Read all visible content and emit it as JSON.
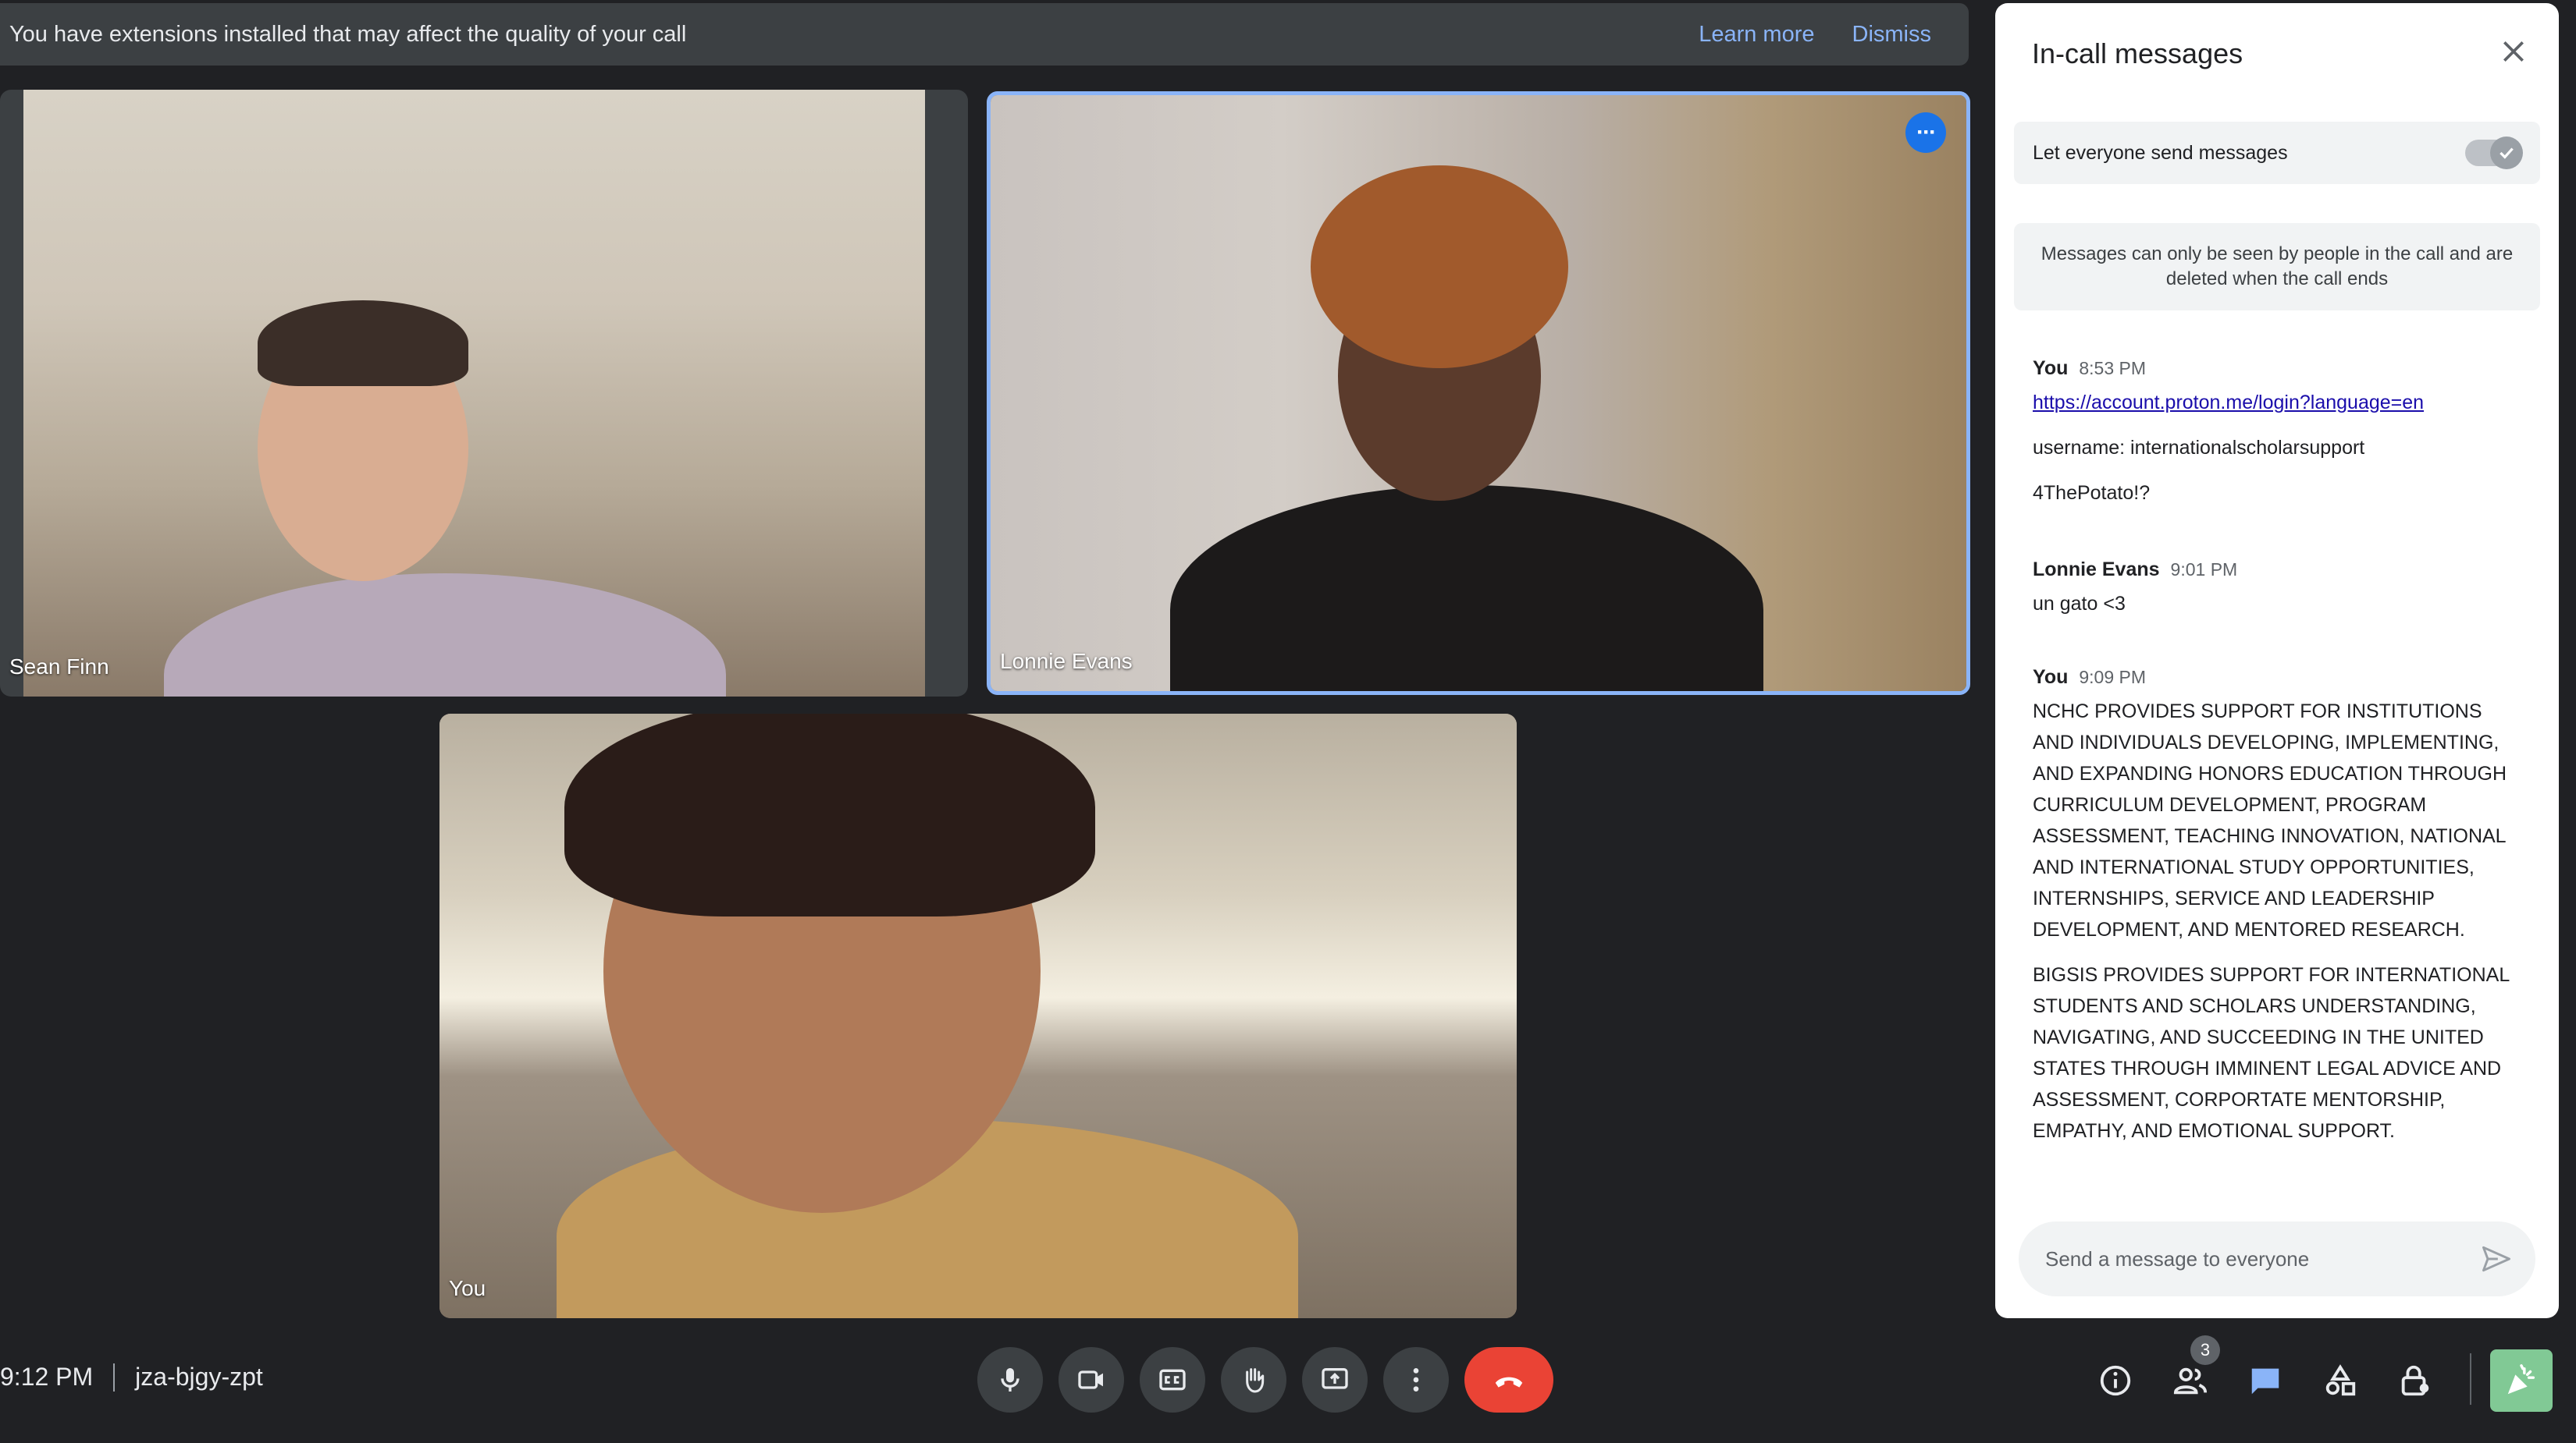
{
  "banner": {
    "text": "You have extensions installed that may affect the quality of your call",
    "learn_more": "Learn more",
    "dismiss": "Dismiss"
  },
  "tiles": {
    "sean": "Sean Finn",
    "lonnie": "Lonnie Evans",
    "you": "You"
  },
  "panel": {
    "title": "In-call messages",
    "toggle_label": "Let everyone send messages",
    "toggle_on": true,
    "info": "Messages can only be seen by people in the call and are deleted when the call ends",
    "messages": [
      {
        "sender": "You",
        "time": "8:53 PM",
        "link": "https://account.proton.me/login?language=en",
        "lines": [
          "username: internationalscholarsupport",
          "4ThePotato!?"
        ]
      },
      {
        "sender": "Lonnie Evans",
        "time": "9:01 PM",
        "lines": [
          "un gato <3"
        ]
      },
      {
        "sender": "You",
        "time": "9:09 PM",
        "lines": [
          "NCHC PROVIDES SUPPORT FOR INSTITUTIONS AND INDIVIDUALS DEVELOPING, IMPLEMENTING, AND EXPANDING HONORS EDUCATION THROUGH CURRICULUM DEVELOPMENT, PROGRAM ASSESSMENT, TEACHING INNOVATION, NATIONAL AND INTERNATIONAL STUDY OPPORTUNITIES, INTERNSHIPS, SERVICE AND LEADERSHIP DEVELOPMENT, AND MENTORED RESEARCH.",
          "BIGSIS PROVIDES SUPPORT FOR INTERNATIONAL STUDENTS AND SCHOLARS UNDERSTANDING, NAVIGATING, AND SUCCEEDING IN THE UNITED STATES THROUGH IMMINENT LEGAL ADVICE AND ASSESSMENT, CORPORTATE MENTORSHIP, EMPATHY, AND EMOTIONAL SUPPORT."
        ]
      }
    ],
    "compose_placeholder": "Send a message to everyone"
  },
  "footer": {
    "time": "9:12 PM",
    "meeting_code": "jza-bjgy-zpt",
    "people_count": "3"
  },
  "colors": {
    "accent": "#8ab4f8",
    "hangup": "#ea4335",
    "activities": "#81c995",
    "chat_active": "#8ab4f8"
  }
}
